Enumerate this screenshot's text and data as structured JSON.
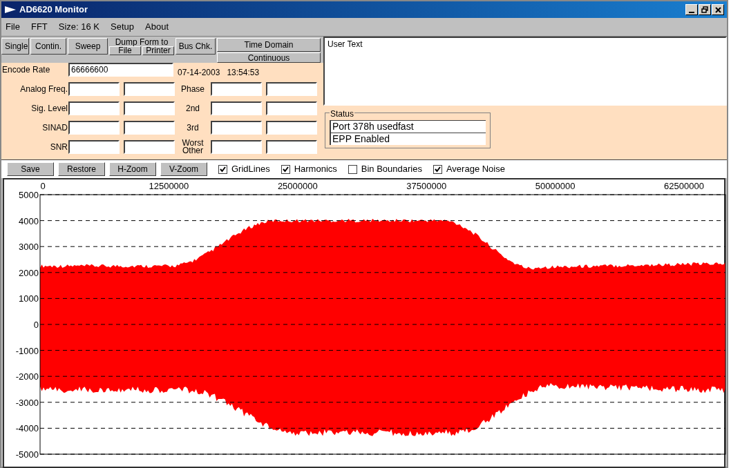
{
  "window": {
    "title": "AD6620 Monitor"
  },
  "menu": [
    "File",
    "FFT",
    "Size: 16 K",
    "Setup",
    "About"
  ],
  "toolbar": {
    "buttons": [
      "Single",
      "Contin.",
      "Sweep"
    ],
    "dump_label": "Dump Form to",
    "dump_buttons": [
      "File",
      "Printer"
    ],
    "bus_button": "Bus Chk.",
    "mode_buttons": [
      "Time Domain",
      "Continuous"
    ]
  },
  "form": {
    "encode_rate": {
      "label": "Encode Rate",
      "value": "66666600"
    },
    "timestamp": "07-14-2003   13:54:53",
    "rows": [
      {
        "label": "Analog Freq.",
        "label2": "Phase"
      },
      {
        "label": "Sig. Level",
        "label2": "2nd"
      },
      {
        "label": "SINAD",
        "label2": "3rd"
      },
      {
        "label": "SNR",
        "label2": "Worst Other"
      }
    ]
  },
  "user_text": {
    "value": "User Text"
  },
  "status": {
    "title": "Status",
    "lines": [
      "Port 378h usedfast",
      "EPP Enabled"
    ]
  },
  "plot_toolbar": {
    "buttons": [
      "Save",
      "Restore",
      "H-Zoom",
      "V-Zoom"
    ],
    "options": [
      {
        "label": "GridLines",
        "checked": true
      },
      {
        "label": "Harmonics",
        "checked": true
      },
      {
        "label": "Bin Boundaries",
        "checked": false
      },
      {
        "label": "Average Noise",
        "checked": true
      }
    ]
  },
  "plot": {
    "x_tick_labels": [
      "0",
      "12500000",
      "25000000",
      "37500000",
      "50000000",
      "62500000"
    ],
    "y_tick_labels": [
      "5000",
      "4000",
      "3000",
      "2000",
      "1000",
      "0",
      "-1000",
      "-2000",
      "-3000",
      "-4000",
      "-5000"
    ]
  }
}
